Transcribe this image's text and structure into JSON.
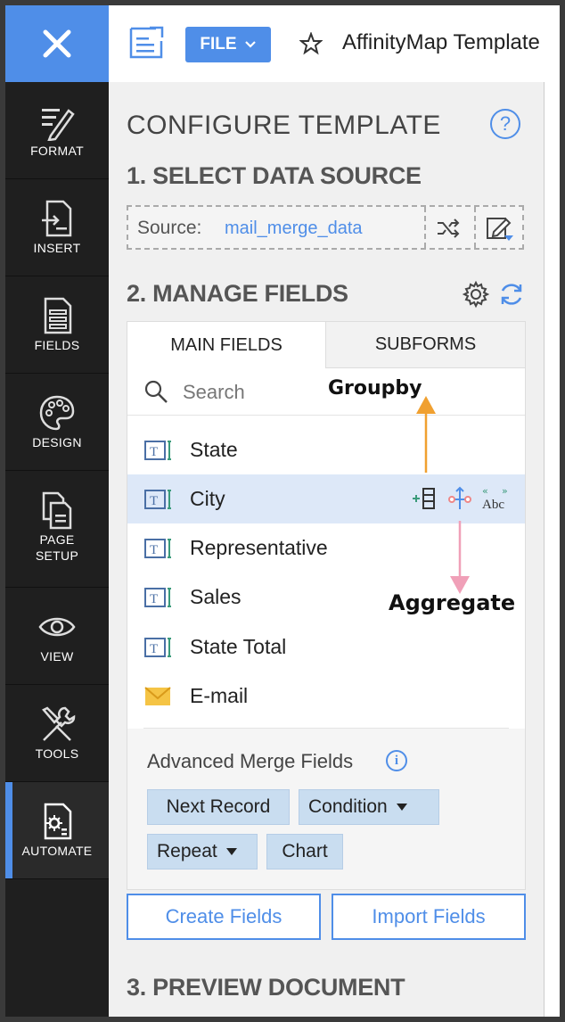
{
  "topbar": {
    "close_label": "✕",
    "file_label": "FILE",
    "doc_title": "AffinityMap Template"
  },
  "rail": {
    "items": [
      {
        "label": "FORMAT",
        "icon": "pen-icon"
      },
      {
        "label": "INSERT",
        "icon": "insert-icon"
      },
      {
        "label": "FIELDS",
        "icon": "fields-icon"
      },
      {
        "label": "DESIGN",
        "icon": "palette-icon"
      },
      {
        "label": "PAGE\nSETUP",
        "icon": "page-setup-icon"
      },
      {
        "label": "VIEW",
        "icon": "eye-icon"
      },
      {
        "label": "TOOLS",
        "icon": "tools-icon"
      },
      {
        "label": "AUTOMATE",
        "icon": "automate-icon"
      }
    ],
    "active": "AUTOMATE"
  },
  "panel": {
    "title": "CONFIGURE TEMPLATE",
    "help": "?",
    "section1": "1. SELECT DATA SOURCE",
    "source_label": "Source:",
    "source_value": "mail_merge_data",
    "section2": "2. MANAGE FIELDS",
    "section3": "3. PREVIEW DOCUMENT",
    "tabs": {
      "main": "MAIN FIELDS",
      "sub": "SUBFORMS"
    },
    "search_placeholder": "Search",
    "fields": [
      {
        "label": "State",
        "icon": "text-field-icon"
      },
      {
        "label": "City",
        "icon": "text-field-icon",
        "selected": true
      },
      {
        "label": "Representative",
        "icon": "text-field-icon"
      },
      {
        "label": "Sales",
        "icon": "text-field-icon"
      },
      {
        "label": "State Total",
        "icon": "text-field-icon"
      },
      {
        "label": "E-mail",
        "icon": "email-icon"
      }
    ],
    "advanced_title": "Advanced Merge Fields",
    "advanced_info": "i",
    "chips": {
      "next_record": "Next Record",
      "condition": "Condition",
      "repeat": "Repeat",
      "chart": "Chart"
    },
    "create_fields": "Create Fields",
    "import_fields": "Import Fields"
  },
  "annotations": {
    "groupby": "Groupby",
    "aggregate": "Aggregate"
  },
  "colors": {
    "accent": "#4f8ee8",
    "rail_bg": "#1f1f1f",
    "groupby_arrow": "#f0a030",
    "aggregate_arrow": "#f0a0b8"
  }
}
